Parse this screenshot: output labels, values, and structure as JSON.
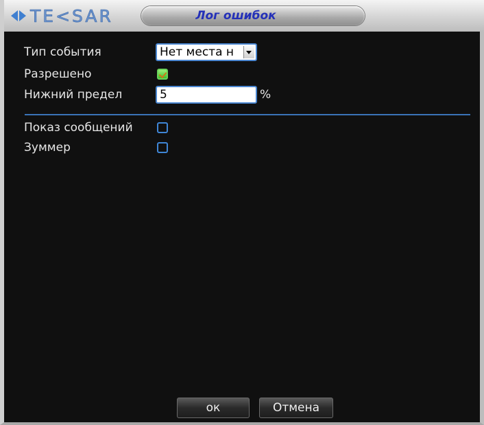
{
  "window": {
    "brand": "TE<SAR",
    "title": "Лог ошибок"
  },
  "form": {
    "event_type_label": "Тип события",
    "event_type_value": "Нет места н",
    "enabled_label": "Разрешено",
    "enabled_checked": true,
    "lower_limit_label": "Нижний предел",
    "lower_limit_value": "5",
    "lower_limit_unit": "%",
    "show_message_label": "Показ сообщений",
    "show_message_checked": false,
    "buzzer_label": "Зуммер",
    "buzzer_checked": false
  },
  "footer": {
    "ok_label": "ок",
    "cancel_label": "Отмена"
  },
  "colors": {
    "accent": "#4a86d0",
    "title_text": "#2430b8",
    "background": "#101010",
    "check_on": "#3bc02a"
  }
}
